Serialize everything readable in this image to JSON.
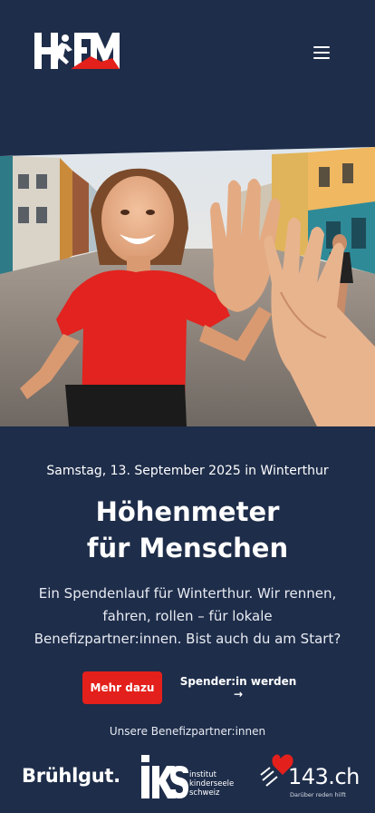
{
  "header": {
    "logo_text": "HFM",
    "menu_icon": "hamburger-icon"
  },
  "hero": {
    "image": "runner-high-five-photo"
  },
  "event": {
    "date_line": "Samstag, 13. September 2025 in Winterthur",
    "headline_line1": "Höhenmeter",
    "headline_line2": "für Menschen",
    "intro": "Ein Spendenlauf für Winterthur. Wir rennen, fahren, rollen – für lokale Benefizpartner:innen. Bist auch du am Start?"
  },
  "actions": {
    "primary_label": "Mehr dazu",
    "secondary_label": "Spender:in werden →"
  },
  "partners": {
    "title": "Unsere Benefizpartner:innen",
    "items": [
      {
        "name": "Brühlgut."
      },
      {
        "name": "iks",
        "lines": [
          "institut",
          "kinderseele",
          "schweiz"
        ]
      },
      {
        "name": "143.ch",
        "tagline": "Darüber reden hilft"
      }
    ]
  },
  "colors": {
    "background": "#1e2d4a",
    "accent": "#e3201b",
    "text": "#ffffff"
  }
}
